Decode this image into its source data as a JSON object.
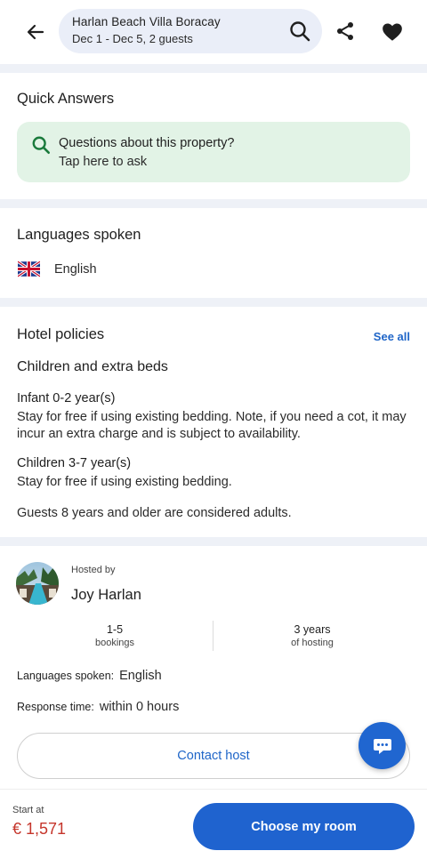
{
  "header": {
    "property_name": "Harlan Beach Villa Boracay",
    "dates_guests": "Dec 1 - Dec 5, 2 guests",
    "icons": {
      "back": "arrow-left-icon",
      "search": "search-icon",
      "share": "share-icon",
      "favorite": "heart-icon"
    }
  },
  "quick_answers": {
    "title": "Quick Answers",
    "question": "Questions about this property?",
    "cta": "Tap here to ask",
    "card_color": "#e2f3e6"
  },
  "languages": {
    "title": "Languages spoken",
    "items": [
      {
        "flag": "uk-flag-icon",
        "name": "English"
      }
    ]
  },
  "policies": {
    "title": "Hotel policies",
    "see_all": "See all",
    "subtitle": "Children and extra beds",
    "items": [
      {
        "heading": "Infant 0-2 year(s)",
        "body": "Stay for free if using existing bedding. Note, if you need a cot, it may incur an extra charge and is subject to availability."
      },
      {
        "heading": "Children 3-7 year(s)",
        "body": "Stay for free if using existing bedding."
      }
    ],
    "adults_note": "Guests 8 years and older are considered adults."
  },
  "host": {
    "hosted_by_label": "Hosted by",
    "name": "Joy Harlan",
    "stats": [
      {
        "value": "1-5",
        "label": "bookings"
      },
      {
        "value": "3 years",
        "label": "of hosting"
      }
    ],
    "languages_label": "Languages spoken:",
    "languages_value": "English",
    "response_label": "Response time:",
    "response_value": "within 0 hours",
    "contact_label": "Contact host"
  },
  "footer": {
    "start_at_label": "Start at",
    "price": "€ 1,571",
    "cta": "Choose my room"
  },
  "colors": {
    "accent": "#1f63cf",
    "price": "#c5352b",
    "search_pill": "#eaeef8",
    "separator": "#eef1f7"
  }
}
